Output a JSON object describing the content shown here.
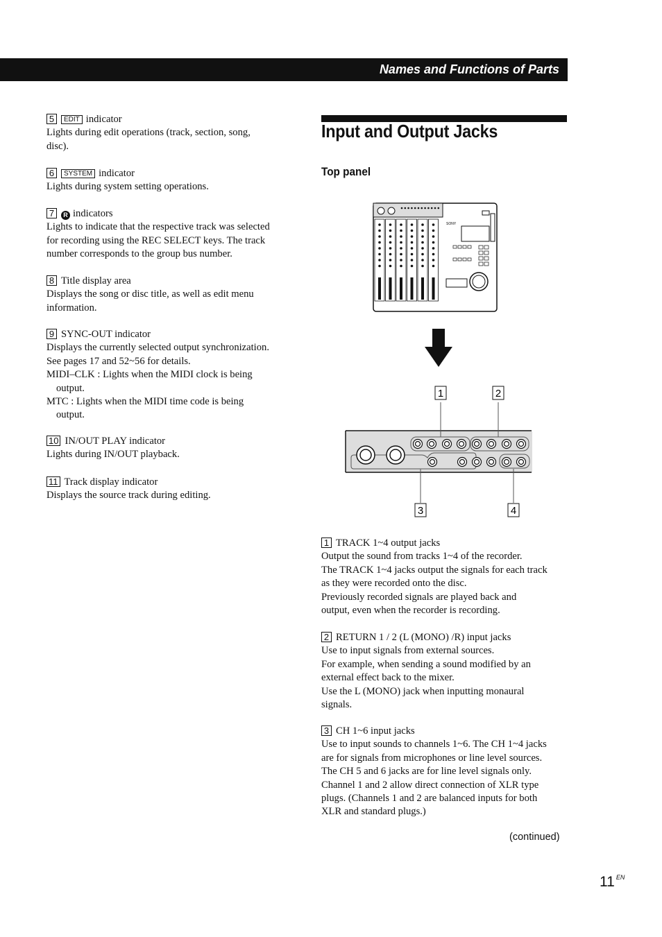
{
  "header": {
    "section": "Names and Functions of Parts"
  },
  "left": [
    {
      "num": "5",
      "badge": "EDIT",
      "label": "indicator",
      "lines": [
        "Lights during edit operations (track, section, song,",
        "disc)."
      ]
    },
    {
      "num": "6",
      "badge": "SYSTEM",
      "label": "indicator",
      "lines": [
        "Lights during system setting operations."
      ]
    },
    {
      "num": "7",
      "rmark": "R",
      "label": "indicators",
      "lines": [
        "Lights to indicate that the respective track was selected",
        "for recording using the REC SELECT keys. The track",
        "number corresponds to the group bus number."
      ]
    },
    {
      "num": "8",
      "label": "Title display area",
      "lines": [
        "Displays the song or disc title, as well as edit menu",
        "information."
      ]
    },
    {
      "num": "9",
      "label": "SYNC-OUT indicator",
      "lines": [
        "Displays the currently selected output synchronization.",
        "See pages 17 and 52~56 for details.",
        "MIDI–CLK : Lights when the MIDI clock is being",
        "output.",
        "MTC : Lights when the MIDI time code is being",
        "output."
      ]
    },
    {
      "num": "10",
      "label": "IN/OUT PLAY indicator",
      "lines": [
        "Lights during IN/OUT playback."
      ]
    },
    {
      "num": "11",
      "label": "Track display indicator",
      "lines": [
        "Displays the source track during editing."
      ]
    }
  ],
  "main": {
    "title": "Input and Output Jacks",
    "subtitle": "Top panel",
    "diagram": {
      "device_brand": "SONY",
      "callouts": [
        "1",
        "2",
        "3",
        "4"
      ]
    },
    "items": [
      {
        "num": "1",
        "label": "TRACK 1~4 output jacks",
        "lines": [
          "Output the sound from tracks 1~4 of the recorder.",
          "The TRACK 1~4 jacks output the signals for each track",
          "as they were recorded onto the disc.",
          "Previously recorded signals are played back and",
          "output, even when the recorder is recording."
        ]
      },
      {
        "num": "2",
        "label": "RETURN 1 / 2 (L (MONO) /R) input jacks",
        "lines": [
          "Use to input signals from external sources.",
          "For example, when sending a sound modified by an",
          "external effect back to the mixer.",
          "Use the L (MONO) jack when inputting monaural",
          "signals."
        ]
      },
      {
        "num": "3",
        "label": "CH 1~6 input jacks",
        "lines": [
          "Use to input sounds to channels 1~6. The CH 1~4 jacks",
          "are for signals from microphones or line level sources.",
          "The CH 5 and 6 jacks are for line level signals only.",
          "Channel 1 and 2 allow direct connection of XLR type",
          "plugs. (Channels 1 and 2 are balanced inputs for both",
          "XLR and standard plugs.)"
        ]
      }
    ],
    "continued": "(continued)"
  },
  "footer": {
    "page_number": "11",
    "lang": "EN"
  }
}
